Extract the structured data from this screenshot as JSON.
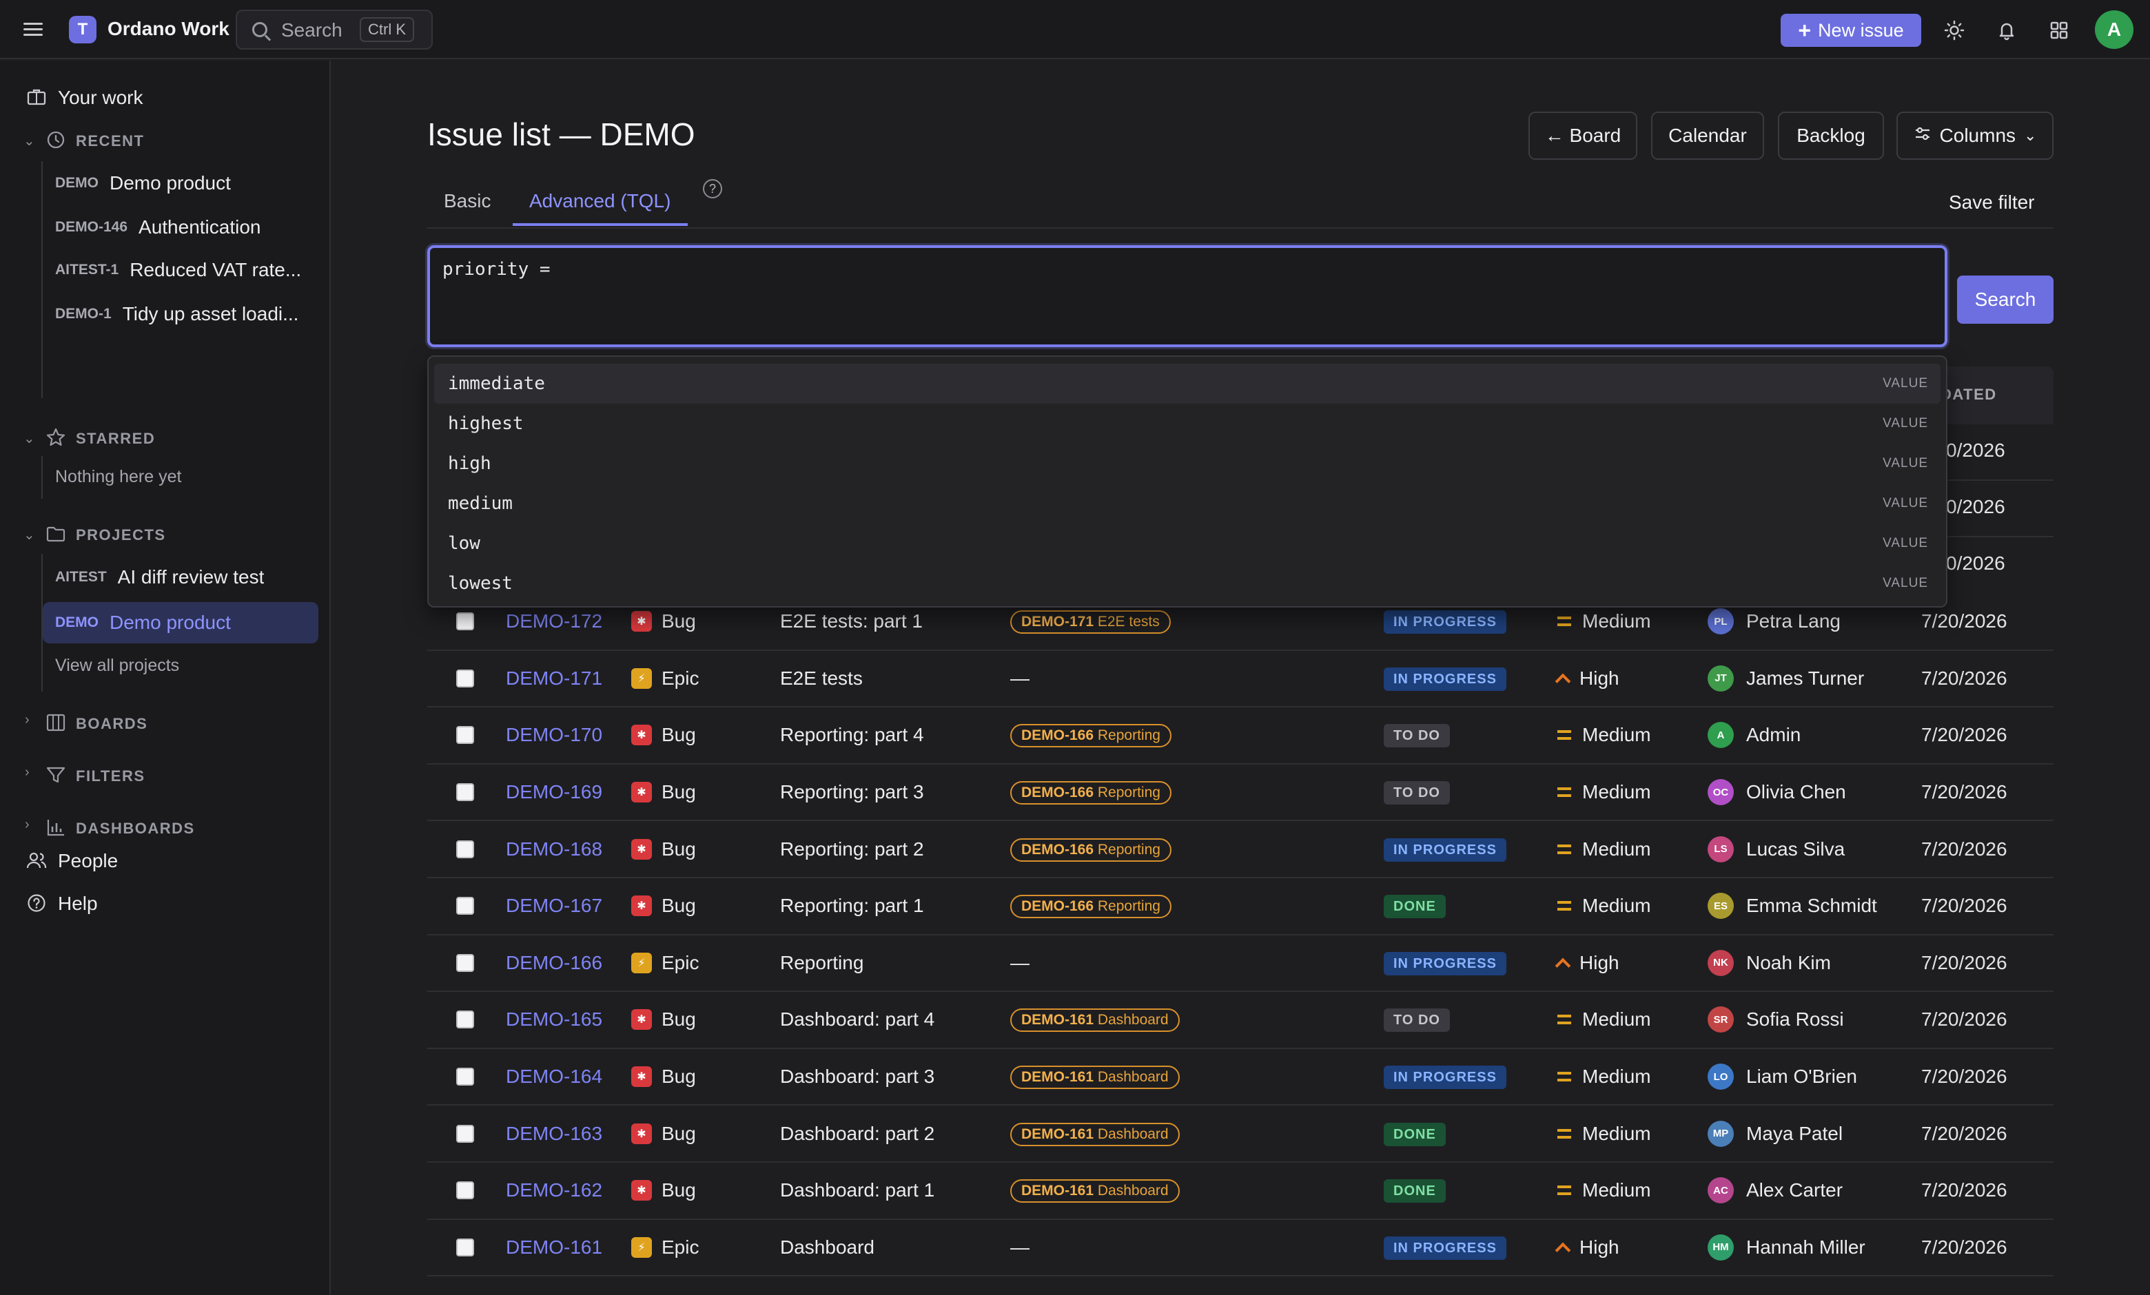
{
  "topbar": {
    "logo_letter": "T",
    "app_name": "Ordano Work",
    "search_label": "Search",
    "search_shortcut": "Ctrl K",
    "new_issue_label": "New issue",
    "avatar_initial": "A"
  },
  "sidebar": {
    "your_work": "Your work",
    "recent_title": "RECENT",
    "recent": [
      {
        "key": "DEMO",
        "label": "Demo product"
      },
      {
        "key": "DEMO-146",
        "label": "Authentication"
      },
      {
        "key": "AITEST-1",
        "label": "Reduced VAT rate..."
      },
      {
        "key": "DEMO-1",
        "label": "Tidy up asset loadi..."
      }
    ],
    "starred_title": "STARRED",
    "starred_empty": "Nothing here yet",
    "projects_title": "PROJECTS",
    "projects": [
      {
        "key": "AITEST",
        "label": "AI diff review test"
      },
      {
        "key": "DEMO",
        "label": "Demo product"
      }
    ],
    "view_all_projects": "View all projects",
    "boards_title": "BOARDS",
    "filters_title": "FILTERS",
    "dashboards_title": "DASHBOARDS",
    "people": "People",
    "help": "Help"
  },
  "main": {
    "title": "Issue list — DEMO",
    "views": {
      "board": "← Board",
      "calendar": "Calendar",
      "backlog": "Backlog",
      "columns": "Columns"
    },
    "tabs": {
      "basic": "Basic",
      "advanced": "Advanced (TQL)",
      "help": "?"
    },
    "save_filter": "Save filter",
    "query": "priority = ",
    "search_button": "Search",
    "suggestions": [
      {
        "value": "immediate",
        "kind": "VALUE"
      },
      {
        "value": "highest",
        "kind": "VALUE"
      },
      {
        "value": "high",
        "kind": "VALUE"
      },
      {
        "value": "medium",
        "kind": "VALUE"
      },
      {
        "value": "low",
        "kind": "VALUE"
      },
      {
        "value": "lowest",
        "kind": "VALUE"
      }
    ],
    "updated_header_fragment": "DATED",
    "hidden_row_dates": [
      "0/2026",
      "0/2026",
      "0/2026"
    ],
    "rows": [
      {
        "key": "DEMO-172",
        "type": "Bug",
        "summary": "E2E tests: part 1",
        "parent_key": "DEMO-171",
        "parent_name": "E2E tests",
        "status": "IN PROGRESS",
        "priority": "Medium",
        "assignee": "Petra Lang",
        "initials": "PL",
        "avatar_color": "#5b6fd1",
        "updated": "7/20/2026"
      },
      {
        "key": "DEMO-171",
        "type": "Epic",
        "summary": "E2E tests",
        "parent_key": "",
        "parent_name": "",
        "parent_dash": "—",
        "status": "IN PROGRESS",
        "priority": "High",
        "assignee": "James Turner",
        "initials": "JT",
        "avatar_color": "#3f9b4a",
        "updated": "7/20/2026"
      },
      {
        "key": "DEMO-170",
        "type": "Bug",
        "summary": "Reporting: part 4",
        "parent_key": "DEMO-166",
        "parent_name": "Reporting",
        "status": "TO DO",
        "priority": "Medium",
        "assignee": "Admin",
        "initials": "A",
        "avatar_color": "#2f9e4f",
        "updated": "7/20/2026"
      },
      {
        "key": "DEMO-169",
        "type": "Bug",
        "summary": "Reporting: part 3",
        "parent_key": "DEMO-166",
        "parent_name": "Reporting",
        "status": "TO DO",
        "priority": "Medium",
        "assignee": "Olivia Chen",
        "initials": "OC",
        "avatar_color": "#b04fc6",
        "updated": "7/20/2026"
      },
      {
        "key": "DEMO-168",
        "type": "Bug",
        "summary": "Reporting: part 2",
        "parent_key": "DEMO-166",
        "parent_name": "Reporting",
        "status": "IN PROGRESS",
        "priority": "Medium",
        "assignee": "Lucas Silva",
        "initials": "LS",
        "avatar_color": "#c4477e",
        "updated": "7/20/2026"
      },
      {
        "key": "DEMO-167",
        "type": "Bug",
        "summary": "Reporting: part 1",
        "parent_key": "DEMO-166",
        "parent_name": "Reporting",
        "status": "DONE",
        "priority": "Medium",
        "assignee": "Emma Schmidt",
        "initials": "ES",
        "avatar_color": "#a89a2e",
        "updated": "7/20/2026"
      },
      {
        "key": "DEMO-166",
        "type": "Epic",
        "summary": "Reporting",
        "parent_key": "",
        "parent_name": "",
        "parent_dash": "—",
        "status": "IN PROGRESS",
        "priority": "High",
        "assignee": "Noah Kim",
        "initials": "NK",
        "avatar_color": "#c2404f",
        "updated": "7/20/2026"
      },
      {
        "key": "DEMO-165",
        "type": "Bug",
        "summary": "Dashboard: part 4",
        "parent_key": "DEMO-161",
        "parent_name": "Dashboard",
        "status": "TO DO",
        "priority": "Medium",
        "assignee": "Sofia Rossi",
        "initials": "SR",
        "avatar_color": "#c24545",
        "updated": "7/20/2026"
      },
      {
        "key": "DEMO-164",
        "type": "Bug",
        "summary": "Dashboard: part 3",
        "parent_key": "DEMO-161",
        "parent_name": "Dashboard",
        "status": "IN PROGRESS",
        "priority": "Medium",
        "assignee": "Liam O'Brien",
        "initials": "LO",
        "avatar_color": "#3d78c6",
        "updated": "7/20/2026"
      },
      {
        "key": "DEMO-163",
        "type": "Bug",
        "summary": "Dashboard: part 2",
        "parent_key": "DEMO-161",
        "parent_name": "Dashboard",
        "status": "DONE",
        "priority": "Medium",
        "assignee": "Maya Patel",
        "initials": "MP",
        "avatar_color": "#4a7fb8",
        "updated": "7/20/2026"
      },
      {
        "key": "DEMO-162",
        "type": "Bug",
        "summary": "Dashboard: part 1",
        "parent_key": "DEMO-161",
        "parent_name": "Dashboard",
        "status": "DONE",
        "priority": "Medium",
        "assignee": "Alex Carter",
        "initials": "AC",
        "avatar_color": "#b5468e",
        "updated": "7/20/2026"
      },
      {
        "key": "DEMO-161",
        "type": "Epic",
        "summary": "Dashboard",
        "parent_key": "",
        "parent_name": "",
        "parent_dash": "—",
        "status": "IN PROGRESS",
        "priority": "High",
        "assignee": "Hannah Miller",
        "initials": "HM",
        "avatar_color": "#2f9e6a",
        "updated": "7/20/2026"
      }
    ]
  }
}
